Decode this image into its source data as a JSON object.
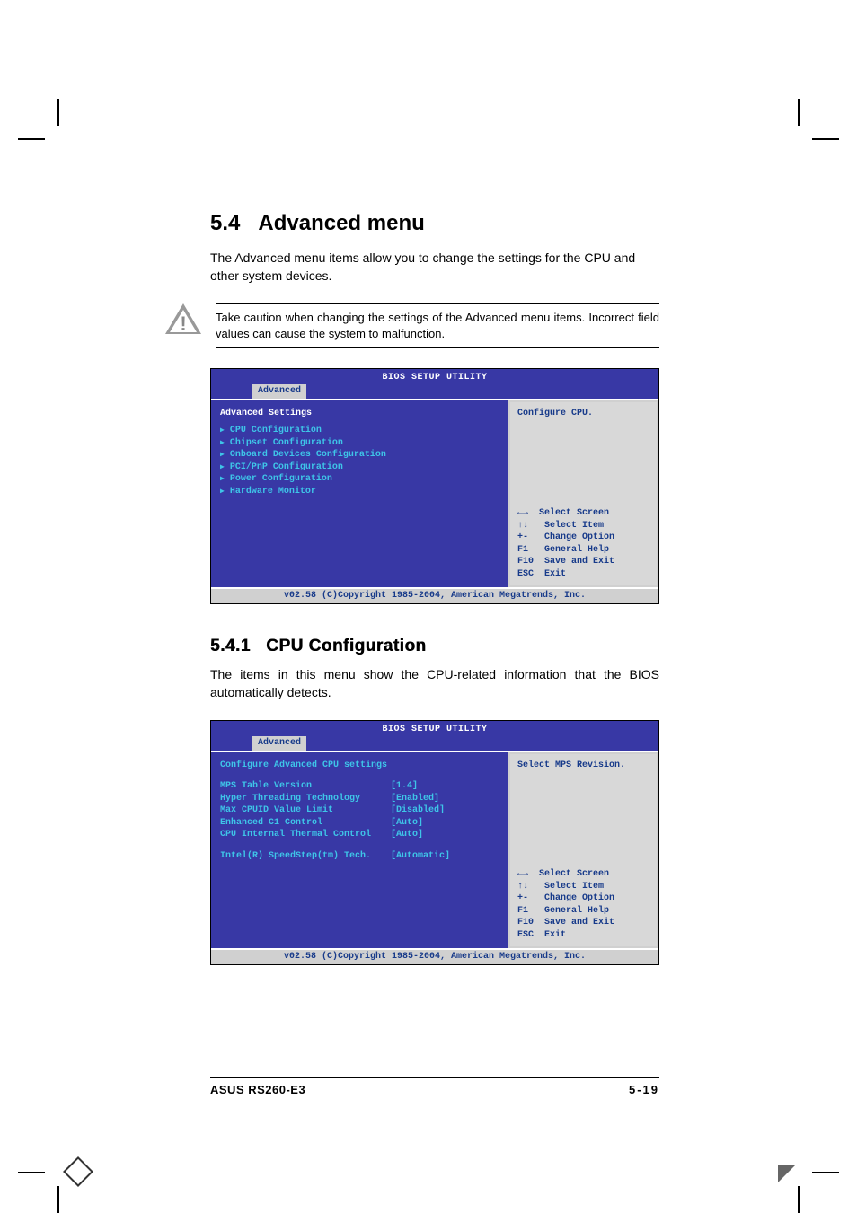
{
  "section": {
    "number": "5.4",
    "title": "Advanced menu",
    "intro": "The Advanced menu items allow you to change the settings for the CPU and other system devices.",
    "caution": "Take caution when changing the settings of the Advanced menu items. Incorrect field values can cause the system to malfunction."
  },
  "bios1": {
    "title": "BIOS SETUP UTILITY",
    "tab": "Advanced",
    "heading": "Advanced Settings",
    "items": [
      "CPU Configuration",
      "Chipset Configuration",
      "Onboard Devices Configuration",
      "PCI/PnP Configuration",
      "Power Configuration",
      "Hardware Monitor"
    ],
    "help_top": "Configure CPU.",
    "help_bottom": "←→  Select Screen\n↑↓   Select Item\n+-   Change Option\nF1   General Help\nF10  Save and Exit\nESC  Exit",
    "footer": "v02.58 (C)Copyright 1985-2004, American Megatrends, Inc."
  },
  "subsection": {
    "number": "5.4.1",
    "title": "CPU Configuration",
    "intro": "The items in this menu show the CPU-related information that the BIOS automatically detects."
  },
  "bios2": {
    "title": "BIOS SETUP UTILITY",
    "tab": "Advanced",
    "heading": "Configure Advanced CPU settings",
    "settings": [
      {
        "label": "MPS Table Version",
        "value": "[1.4]"
      },
      {
        "label": "Hyper Threading Technology",
        "value": "[Enabled]"
      },
      {
        "label": "Max CPUID Value Limit",
        "value": "[Disabled]"
      },
      {
        "label": "Enhanced C1 Control",
        "value": "[Auto]"
      },
      {
        "label": "CPU Internal Thermal Control",
        "value": "[Auto]"
      }
    ],
    "extra": {
      "label": "Intel(R) SpeedStep(tm) Tech.",
      "value": "[Automatic]"
    },
    "help_top": "Select MPS Revision.",
    "help_bottom": "←→  Select Screen\n↑↓   Select Item\n+-   Change Option\nF1   General Help\nF10  Save and Exit\nESC  Exit",
    "footer": "v02.58 (C)Copyright 1985-2004, American Megatrends, Inc."
  },
  "footer": {
    "left": "ASUS RS260-E3",
    "right": "5-19"
  }
}
